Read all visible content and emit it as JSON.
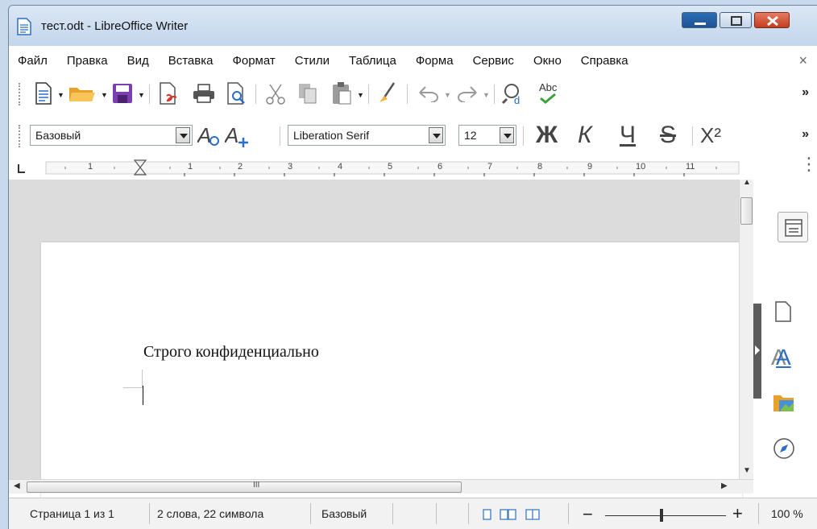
{
  "window": {
    "title": "тест.odt - LibreOffice Writer"
  },
  "menu": {
    "items": [
      "Файл",
      "Правка",
      "Вид",
      "Вставка",
      "Формат",
      "Стили",
      "Таблица",
      "Форма",
      "Сервис",
      "Окно",
      "Справка"
    ],
    "close_glyph": "×"
  },
  "toolbar2": {
    "paragraph_style": "Базовый",
    "font_name": "Liberation Serif",
    "font_size": "12",
    "bold_label": "Ж",
    "italic_label": "К",
    "underline_label": "Ч",
    "strike_label": "S",
    "superscript_label": "X²",
    "more_glyph": "»"
  },
  "toolbar1": {
    "more_glyph": "»",
    "spell_label": "Abc"
  },
  "ruler": {
    "marks": [
      "1",
      "1",
      "2",
      "3",
      "4",
      "5",
      "6",
      "7",
      "8",
      "9",
      "10",
      "11"
    ]
  },
  "document": {
    "text": "Строго конфиденциально"
  },
  "statusbar": {
    "page": "Страница 1 из 1",
    "words": "2 слова, 22 символа",
    "style": "Базовый",
    "zoom": "100 %",
    "zoom_minus": "−",
    "zoom_plus": "+"
  },
  "colors": {
    "accent": "#1e5296",
    "close_red": "#c23c1f",
    "save_icon": "#6b3fa0",
    "folder_icon": "#f5b335"
  }
}
